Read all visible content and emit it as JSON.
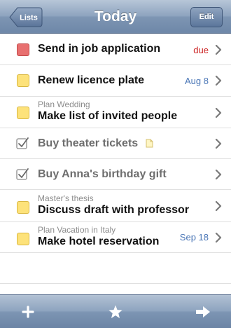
{
  "navbar": {
    "title": "Today",
    "back_label": "Lists",
    "edit_label": "Edit"
  },
  "tasks": [
    {
      "title": "Send in job application",
      "meta": "due",
      "marker": "red",
      "completed": false
    },
    {
      "title": "Renew licence plate",
      "meta": "Aug 8",
      "marker": "yellow",
      "completed": false
    },
    {
      "project": "Plan Wedding",
      "title": "Make list of invited people",
      "marker": "yellow",
      "completed": false
    },
    {
      "title": "Buy theater tickets",
      "marker": "checked",
      "completed": true,
      "has_note": true
    },
    {
      "title": "Buy Anna's birthday gift",
      "marker": "checked",
      "completed": true
    },
    {
      "project": "Master's thesis",
      "title": "Discuss draft with professor",
      "marker": "yellow",
      "completed": false
    },
    {
      "project": "Plan Vacation in Italy",
      "title": "Make hotel reservation",
      "meta": "Sep 18",
      "marker": "yellow",
      "completed": false
    }
  ],
  "toolbar": {
    "icons": [
      "plus-icon",
      "star-icon",
      "arrow-right-icon"
    ]
  },
  "colors": {
    "nav_bar": "#8ea4bf",
    "due_red": "#cc2222",
    "date_blue": "#4a76b6",
    "marker_red": "#e87070",
    "marker_yellow": "#fde27a"
  }
}
